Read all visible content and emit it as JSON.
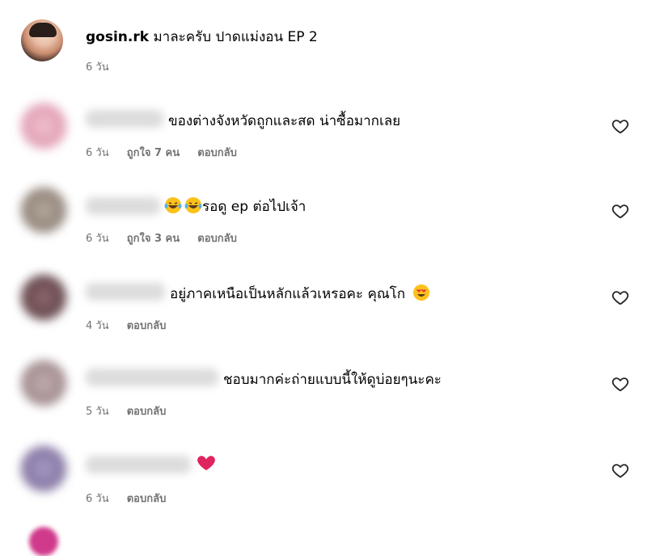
{
  "caption": {
    "username": "gosin.rk",
    "text": "มาละครับ ปาดแม่งอน EP 2",
    "time": "6 วัน"
  },
  "comments": [
    {
      "text": "ของต่างจังหวัดถูกและสด น่าซื้อมากเลย",
      "time": "6 วัน",
      "likes": "ถูกใจ 7 คน",
      "reply": "ตอบกลับ",
      "avatar_color": "#e7b3c4"
    },
    {
      "text": "รอดู ep ต่อไปเจ้า",
      "time": "6 วัน",
      "likes": "ถูกใจ 3 คน",
      "reply": "ตอบกลับ",
      "avatar_color": "#9b8f86",
      "emojis": [
        "grinning-tears-emoji",
        "grinning-tears-emoji"
      ]
    },
    {
      "text": "อยู่ภาคเหนือเป็นหลักแล้วเหรอคะ คุณโก",
      "time": "4 วัน",
      "likes": "",
      "reply": "ตอบกลับ",
      "avatar_color": "#6d4a4e",
      "emojis_after": [
        "heart-eyes-emoji"
      ]
    },
    {
      "text": "ชอบมากค่ะถ่ายแบบนี้ให้ดูบ่อยๆนะคะ",
      "time": "5 วัน",
      "likes": "",
      "reply": "ตอบกลับ",
      "avatar_color": "#a89294"
    },
    {
      "text": "",
      "time": "6 วัน",
      "likes": "",
      "reply": "ตอบกลับ",
      "avatar_color": "#8c7aa8",
      "emojis_after": [
        "red-heart-emoji"
      ]
    }
  ],
  "icons": {
    "like": "heart-outline-icon"
  },
  "colors": {
    "meta_text": "#737373",
    "heart_red": "#e0245e"
  }
}
